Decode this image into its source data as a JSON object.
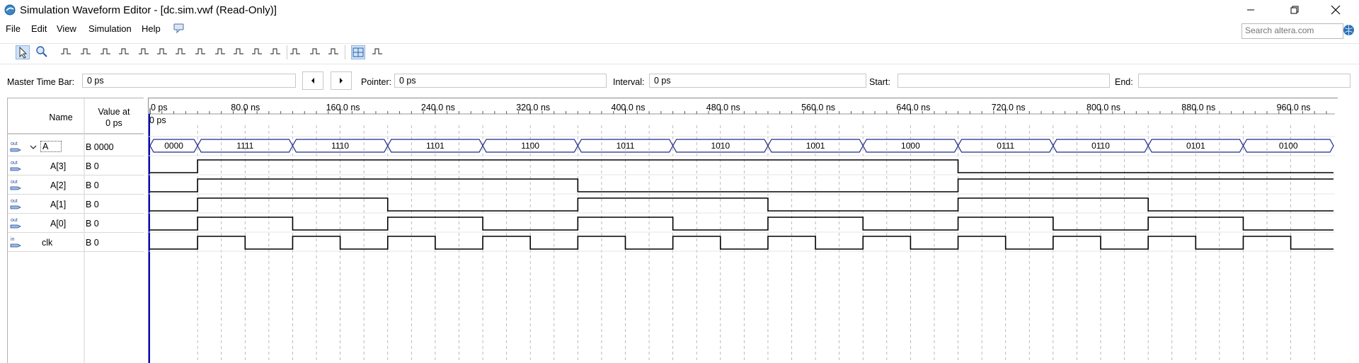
{
  "window": {
    "title": "Simulation Waveform Editor - [dc.sim.vwf (Read-Only)]"
  },
  "menu": [
    "File",
    "Edit",
    "View",
    "Simulation",
    "Help"
  ],
  "search": {
    "placeholder": "Search altera.com"
  },
  "timebar": {
    "master_label": "Master Time Bar:",
    "master_value": "0 ps",
    "pointer_label": "Pointer:",
    "pointer_value": "0 ps",
    "interval_label": "Interval:",
    "interval_value": "0 ps",
    "start_label": "Start:",
    "start_value": "",
    "end_label": "End:",
    "end_value": ""
  },
  "table": {
    "name_header": "Name",
    "value_header_line1": "Value at",
    "value_header_line2": "0 ps",
    "cursor_label": "0 ps"
  },
  "time_ticks": [
    "0 ps",
    "80.0 ns",
    "160.0 ns",
    "240.0 ns",
    "320.0 ns",
    "400.0 ns",
    "480.0 ns",
    "560.0 ns",
    "640.0 ns",
    "720.0 ns",
    "800.0 ns",
    "880.0 ns",
    "960.0 ns"
  ],
  "signals": [
    {
      "id": "A",
      "name": "A",
      "value": "B 0000",
      "type": "out",
      "expanded": true
    },
    {
      "id": "A3",
      "name": "A[3]",
      "value": "B 0",
      "type": "out"
    },
    {
      "id": "A2",
      "name": "A[2]",
      "value": "B 0",
      "type": "out"
    },
    {
      "id": "A1",
      "name": "A[1]",
      "value": "B 0",
      "type": "out"
    },
    {
      "id": "A0",
      "name": "A[0]",
      "value": "B 0",
      "type": "out"
    },
    {
      "id": "clk",
      "name": "clk",
      "value": "B 0",
      "type": "in"
    }
  ],
  "bus_values": [
    "0000",
    "1111",
    "1110",
    "1101",
    "1100",
    "1011",
    "1010",
    "1001",
    "1000",
    "0111",
    "0110",
    "0101",
    "0100"
  ],
  "colors": {
    "bus_border": "#1f2a8a",
    "cursor": "#0000cc",
    "grid": "#a8a8a8"
  }
}
